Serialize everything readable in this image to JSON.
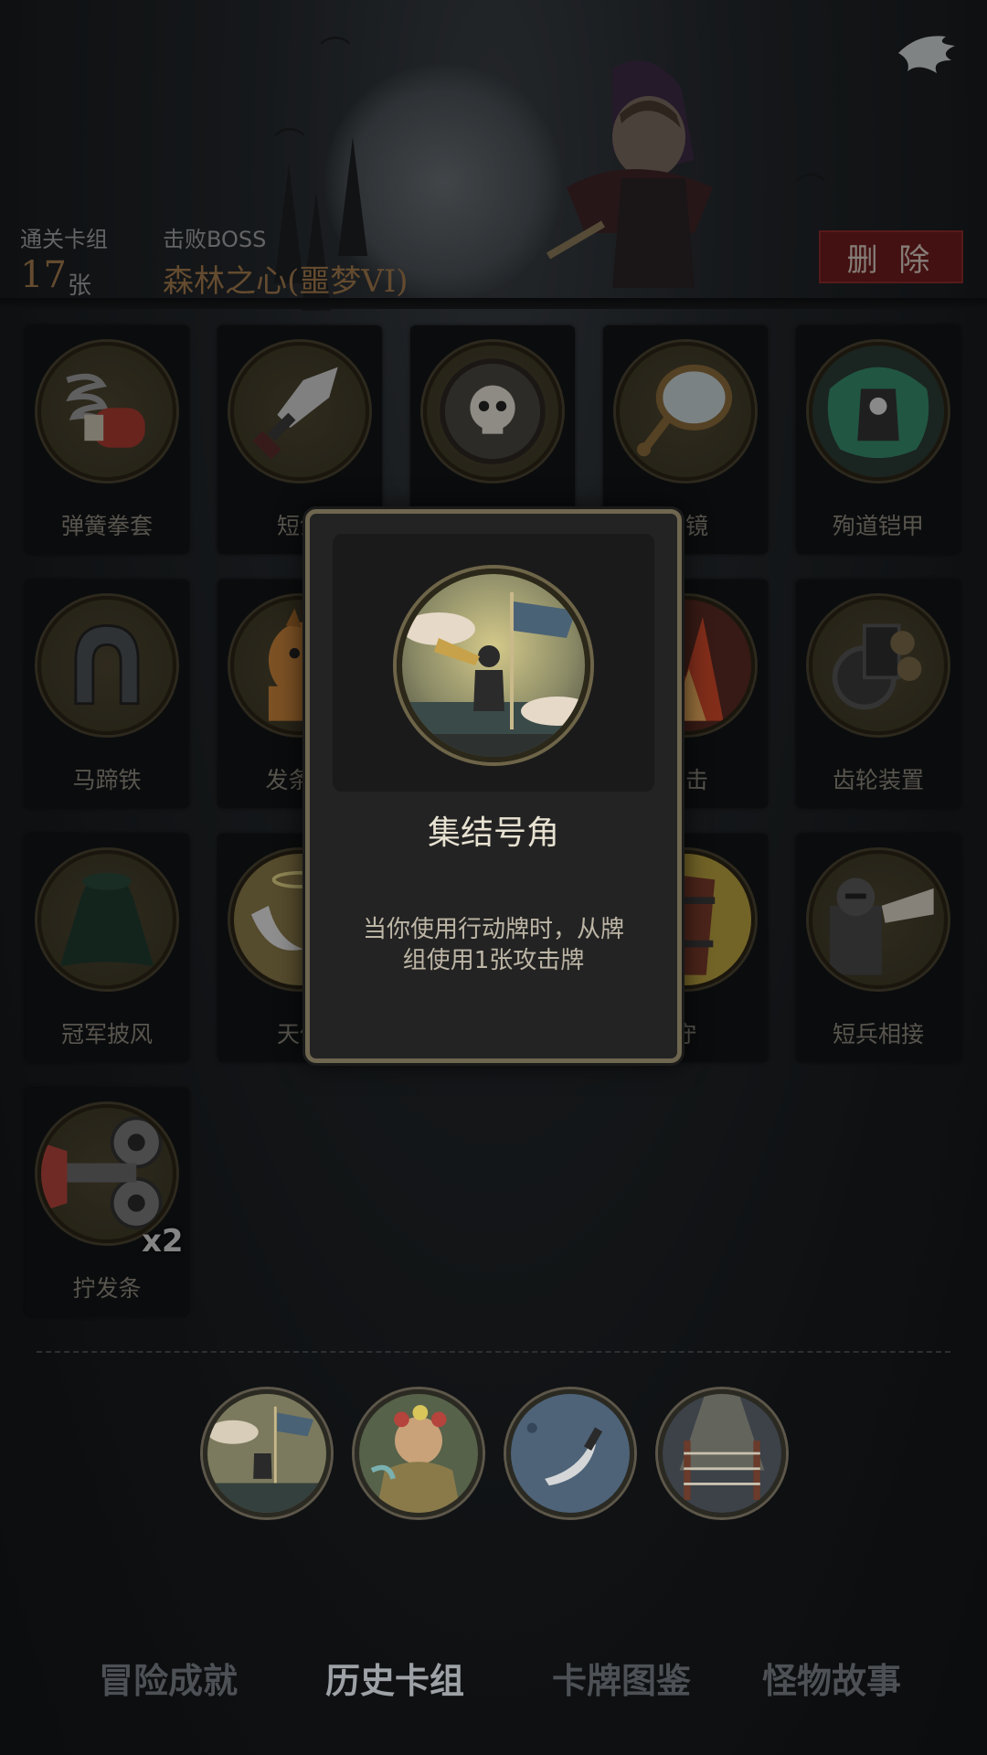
{
  "header": {
    "deck_label": "通关卡组",
    "deck_count": "17",
    "deck_unit": "张",
    "boss_label": "击败BOSS",
    "boss_name": "森林之心(噩梦VI)",
    "delete_label": "删 除"
  },
  "cards": [
    {
      "label": "弹簧拳套",
      "icon": "spring-glove-icon"
    },
    {
      "label": "短剑",
      "icon": "short-sword-icon"
    },
    {
      "label": "",
      "icon": "skull-shield-icon"
    },
    {
      "label": "手镜",
      "icon": "hand-mirror-icon"
    },
    {
      "label": "殉道铠甲",
      "icon": "martyr-armor-icon"
    },
    {
      "label": "马蹄铁",
      "icon": "horseshoe-icon"
    },
    {
      "label": "发条马",
      "icon": "wooden-horse-icon"
    },
    {
      "label": "",
      "icon": "",
      "hidden": true
    },
    {
      "label": "攻击",
      "icon": "fire-icon"
    },
    {
      "label": "齿轮装置",
      "icon": "gear-device-icon"
    },
    {
      "label": "冠军披风",
      "icon": "cape-icon"
    },
    {
      "label": "天使",
      "icon": "angel-icon"
    },
    {
      "label": "",
      "icon": "",
      "hidden": true
    },
    {
      "label": "守",
      "icon": "barrel-icon"
    },
    {
      "label": "短兵相接",
      "icon": "knight-icon"
    },
    {
      "label": "拧发条",
      "icon": "wind-up-key-icon",
      "badge": "x2"
    }
  ],
  "popup": {
    "title": "集结号角",
    "description_line1": "当你使用行动牌时，从牌",
    "description_line2": "组使用1张攻击牌",
    "icon": "rally-horn-icon"
  },
  "relics": [
    "rally-horn-relic",
    "forest-dryad-relic",
    "dagger-relic",
    "boxing-ring-relic"
  ],
  "tabs": [
    {
      "label": "冒险成就",
      "active": false
    },
    {
      "label": "历史卡组",
      "active": true
    },
    {
      "label": "卡牌图鉴",
      "active": false
    },
    {
      "label": "怪物故事",
      "active": false
    }
  ],
  "colors": {
    "accent_gold": "#a27a4c",
    "delete_red": "#6d1c1c",
    "popup_border": "#6f6650"
  }
}
